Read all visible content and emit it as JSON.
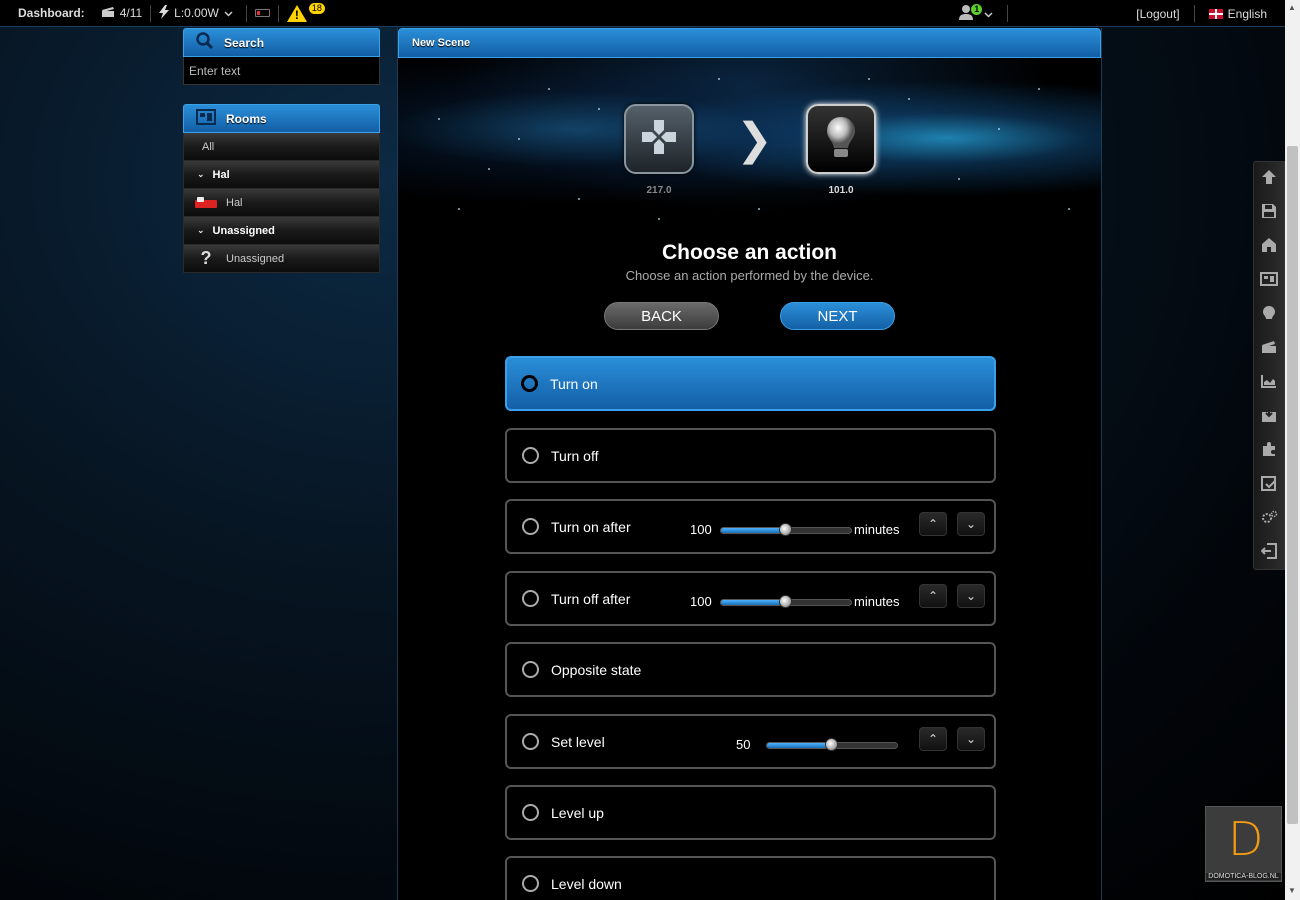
{
  "topbar": {
    "dashboard_label": "Dashboard:",
    "scenes_count": "4/11",
    "power": "L:0.00W",
    "alerts_count": "18",
    "user_badge": "1",
    "logout": "[Logout]",
    "language": "English"
  },
  "search": {
    "title": "Search",
    "placeholder": "Enter text"
  },
  "rooms": {
    "title": "Rooms",
    "all": "All",
    "groups": [
      {
        "name": "Hal",
        "item": "Hal",
        "icon": "bed-icon"
      },
      {
        "name": "Unassigned",
        "item": "Unassigned",
        "icon": "question-icon"
      }
    ]
  },
  "scene": {
    "title": "New Scene",
    "device1_label": "217.0",
    "device2_label": "101.0",
    "heading": "Choose an action",
    "subheading": "Choose an action performed by the device.",
    "back": "BACK",
    "next": "NEXT"
  },
  "actions": [
    {
      "label": "Turn on",
      "selected": true
    },
    {
      "label": "Turn off"
    },
    {
      "label": "Turn on after",
      "value": "100",
      "unit": "minutes",
      "slider_fraction": 0.5
    },
    {
      "label": "Turn off after",
      "value": "100",
      "unit": "minutes",
      "slider_fraction": 0.5
    },
    {
      "label": "Opposite state"
    },
    {
      "label": "Set level",
      "value": "50",
      "slider_fraction": 0.5
    },
    {
      "label": "Level up"
    },
    {
      "label": "Level down"
    }
  ],
  "brand": {
    "logo_letter": "D",
    "site": "DOMOTICA-BLOG.NL",
    "accent": "#f39c12"
  },
  "colors": {
    "header_blue": "#1e7cc6",
    "warning_yellow": "#ffd400",
    "badge_green": "#5cd02a"
  }
}
